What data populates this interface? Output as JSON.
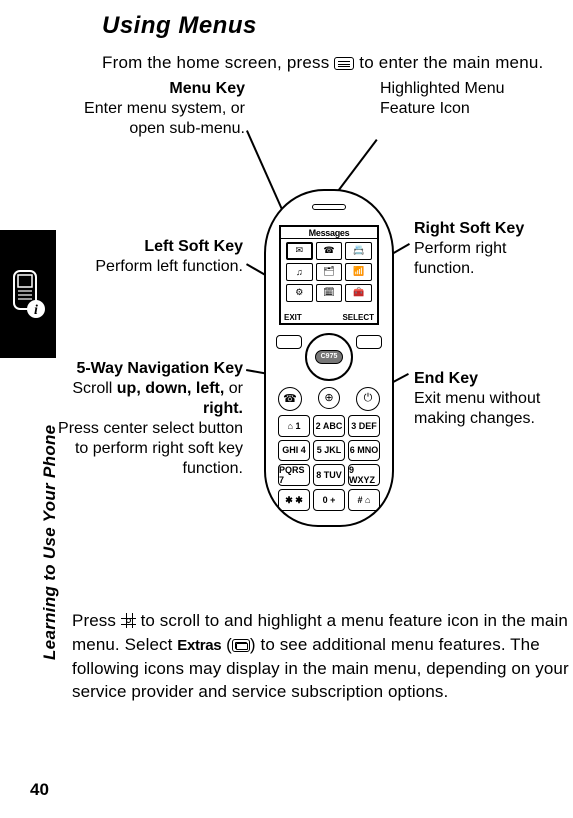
{
  "heading": "Using Menus",
  "intro_before": "From the home screen, press ",
  "intro_after": " to enter the main menu.",
  "side_text": "Learning to Use Your Phone",
  "callouts": {
    "menu_key": {
      "title": "Menu Key",
      "body": "Enter menu system, or open sub-menu."
    },
    "highlighted": {
      "body": "Highlighted Menu Feature Icon"
    },
    "left_soft": {
      "title": "Left Soft Key",
      "body": "Perform left function."
    },
    "right_soft": {
      "title": "Right Soft Key",
      "body": "Perform right function."
    },
    "five_way": {
      "title": "5-Way Navigation Key",
      "body": "Scroll up, down, left, or right. Press center select button to perform right soft key function.",
      "scroll_prefix": "Scroll ",
      "dir_up": "up, down, left,",
      "dir_or": " or ",
      "dir_right": "right.",
      "rest": "Press center select button to perform right soft key function."
    },
    "end_key": {
      "title": "End Key",
      "body": "Exit menu without making changes."
    }
  },
  "phone": {
    "screen_title": "Messages",
    "soft_left": "EXIT",
    "soft_right": "SELECT",
    "nav_label": "C975",
    "keys": [
      "⌂ 1",
      "2 ABC",
      "3 DEF",
      "GHI 4",
      "5 JKL",
      "6 MNO",
      "PQRS 7",
      "8 TUV",
      "9 WXYZ",
      "✱ ✱",
      "0 +",
      "# ⌂"
    ],
    "icons": [
      "✉",
      "☎",
      "📇",
      "♫",
      "🗂",
      "📶",
      "⚙",
      "🗓",
      "🧰"
    ]
  },
  "body": {
    "p1a": "Press ",
    "p1b": " to scroll to and highlight a menu feature icon in the main menu. Select ",
    "extras_label": "Extras",
    "p1c": "  (",
    "p1d": ") to see additional menu features. The following icons may display in the main menu, depending on your service provider and service subscription options."
  },
  "page_number": "40"
}
